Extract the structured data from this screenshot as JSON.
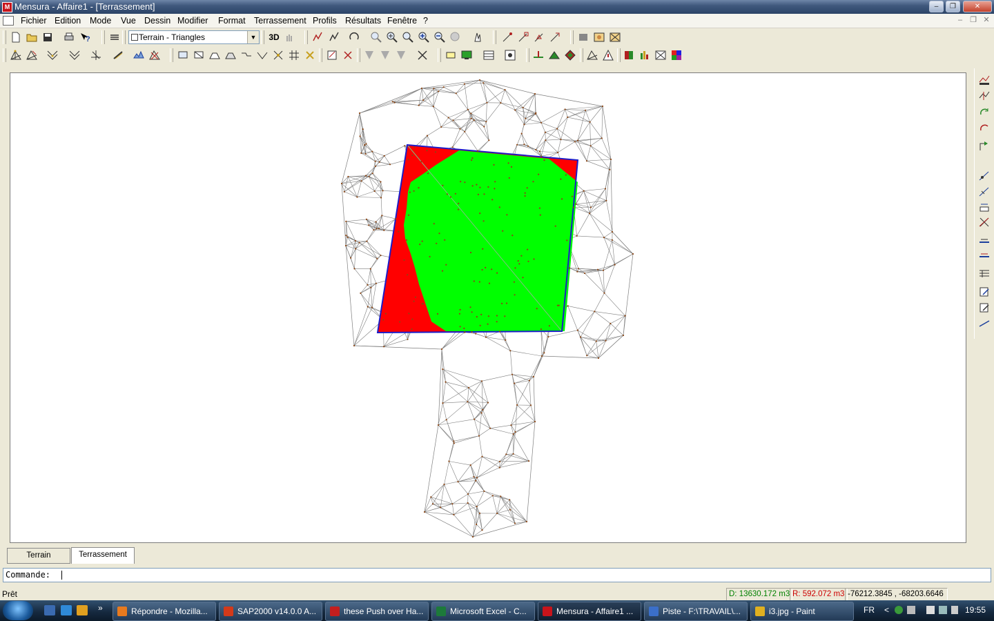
{
  "window": {
    "app_icon_text": "M",
    "title": "Mensura - Affaire1 - [Terrassement]",
    "minimize": "–",
    "restore": "❐",
    "close": "✕"
  },
  "menu": {
    "items": [
      "Fichier",
      "Edition",
      "Mode",
      "Vue",
      "Dessin",
      "Modifier",
      "Format",
      "Terrassement",
      "Profils",
      "Résultats",
      "Fenêtre",
      "?"
    ],
    "mdi_controls": [
      "–",
      "❐",
      "✕"
    ]
  },
  "toolbar": {
    "layer_value": "Terrain - Triangles",
    "dropdown_arrow": "▼",
    "btn_3d": "3D"
  },
  "tabs": [
    "Terrain",
    "Terrassement"
  ],
  "active_tab": "Terrassement",
  "command": {
    "label": "Commande:"
  },
  "status": {
    "ready": "Prêt",
    "deblai": "D: 13630.172 m3",
    "remblai": "R: 592.072 m3",
    "coords": "-76212.3845 , -68203.6646",
    "colors": {
      "deblai": "#008000",
      "remblai": "#cc0000"
    }
  },
  "canvas": {
    "colors": {
      "cut_fill_red": "#ff0000",
      "green_area": "#00ff00",
      "outline": "#1c1cc8",
      "mesh": "#7d7d7d",
      "points": "#8b4513"
    }
  },
  "taskbar": {
    "more": "»",
    "tasks": [
      {
        "label": "Répondre - Mozilla...",
        "icon_color": "#e87a1e"
      },
      {
        "label": "SAP2000 v14.0.0 A...",
        "icon_color": "#d43a1a"
      },
      {
        "label": "these Push over Ha...",
        "icon_color": "#c41e1e"
      },
      {
        "label": "Microsoft Excel - C...",
        "icon_color": "#1d7a3a"
      },
      {
        "label": "Mensura - Affaire1 ...",
        "icon_color": "#c8141b"
      },
      {
        "label": "Piste - F:\\TRAVAIL\\...",
        "icon_color": "#3b6fc9"
      },
      {
        "label": "i3.jpg - Paint",
        "icon_color": "#e0b020"
      }
    ],
    "language": "FR",
    "tray_arrow": "<",
    "clock": "19:55"
  }
}
